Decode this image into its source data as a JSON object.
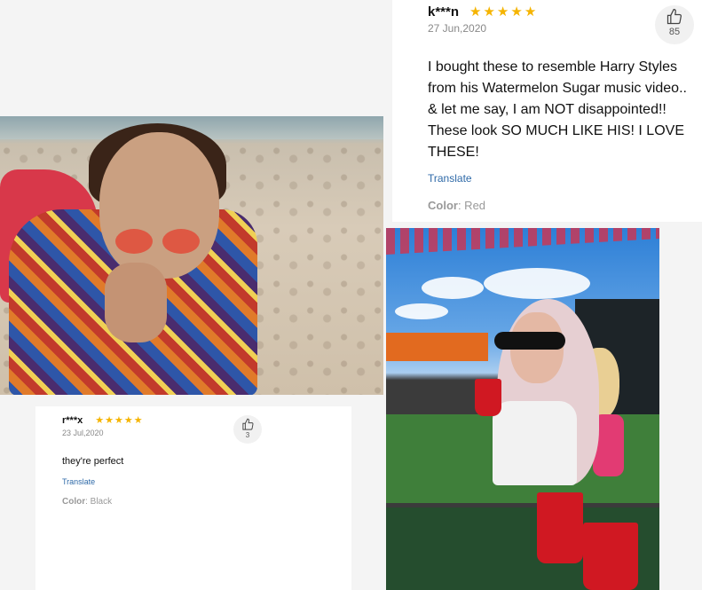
{
  "reviews": [
    {
      "user": "k***n",
      "stars": "★★★★★",
      "date": "27 Jun,2020",
      "likes": "85",
      "text": "I bought these to resemble Harry Styles from his Watermelon Sugar music video.. & let me say, I am NOT disappointed!! These look SO MUCH LIKE HIS! I LOVE THESE!",
      "translate": "Translate",
      "color_label": "Color",
      "color_value": ": Red"
    },
    {
      "user": "r***x",
      "stars": "★★★★★",
      "date": "23 Jul,2020",
      "likes": "3",
      "text": "they're perfect",
      "translate": "Translate",
      "color_label": "Color",
      "color_value": ": Black"
    }
  ],
  "icons": {
    "like": "thumbs-up-icon",
    "star": "star-icon"
  },
  "colors": {
    "star": "#f5b400",
    "translate": "#2f6aa8"
  }
}
